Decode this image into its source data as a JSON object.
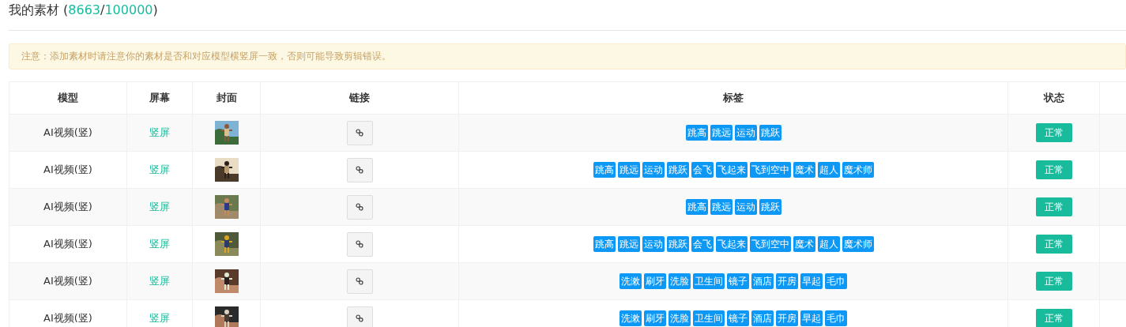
{
  "title": {
    "label": "我的素材 (",
    "used": "8663",
    "separator": "/",
    "total": "100000",
    "close": ")"
  },
  "notice": "注意：添加素材时请注意你的素材是否和对应模型横竖屏一致，否则可能导致剪辑错误。",
  "table": {
    "columns": [
      "模型",
      "屏幕",
      "封面",
      "链接",
      "标签",
      "状态"
    ],
    "rows": [
      {
        "model": "AI视频(竖)",
        "screen": "竖屏",
        "cover": {
          "kind": "picture"
        },
        "tags": [
          "跳高",
          "跳远",
          "运动",
          "跳跃"
        ],
        "status": "正常"
      },
      {
        "model": "AI视频(竖)",
        "screen": "竖屏",
        "cover": {
          "kind": "picture"
        },
        "tags": [
          "跳高",
          "跳远",
          "运动",
          "跳跃",
          "会飞",
          "飞起来",
          "飞到空中",
          "魔术",
          "超人",
          "魔术师"
        ],
        "status": "正常"
      },
      {
        "model": "AI视频(竖)",
        "screen": "竖屏",
        "cover": {
          "kind": "picture"
        },
        "tags": [
          "跳高",
          "跳远",
          "运动",
          "跳跃"
        ],
        "status": "正常"
      },
      {
        "model": "AI视频(竖)",
        "screen": "竖屏",
        "cover": {
          "kind": "picture"
        },
        "tags": [
          "跳高",
          "跳远",
          "运动",
          "跳跃",
          "会飞",
          "飞起来",
          "飞到空中",
          "魔术",
          "超人",
          "魔术师"
        ],
        "status": "正常"
      },
      {
        "model": "AI视频(竖)",
        "screen": "竖屏",
        "cover": {
          "kind": "picture"
        },
        "tags": [
          "洗漱",
          "刷牙",
          "洗脸",
          "卫生间",
          "镜子",
          "酒店",
          "开房",
          "早起",
          "毛巾"
        ],
        "status": "正常"
      },
      {
        "model": "AI视频(竖)",
        "screen": "竖屏",
        "cover": {
          "kind": "picture"
        },
        "tags": [
          "洗漱",
          "刷牙",
          "洗脸",
          "卫生间",
          "镜子",
          "酒店",
          "开房",
          "早起",
          "毛巾"
        ],
        "status": "正常"
      }
    ]
  }
}
